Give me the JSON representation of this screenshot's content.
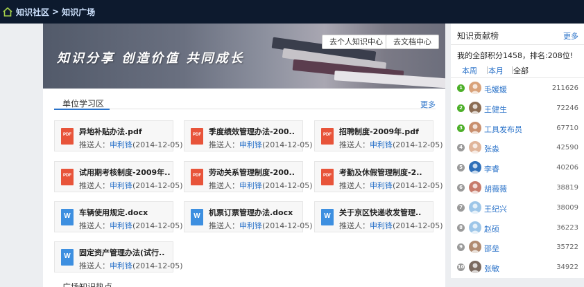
{
  "breadcrumb": {
    "home": "知识社区",
    "separator": ">",
    "current": "知识广场"
  },
  "banner": {
    "slogan": "知识分享  创造价值  共同成长",
    "btn_personal": "去个人知识中心",
    "btn_docs": "去文档中心"
  },
  "section": {
    "title": "单位学习区",
    "more": "更多"
  },
  "docs": [
    {
      "type": "pdf",
      "icon_label": "PDF",
      "title": "异地补贴办法.pdf",
      "by_label": "推送人：",
      "by": "申利锋",
      "date": "(2014-12-05)"
    },
    {
      "type": "pdf",
      "icon_label": "PDF",
      "title": "季度绩效管理办法-200..",
      "by_label": "推送人：",
      "by": "申利锋",
      "date": "(2014-12-05)"
    },
    {
      "type": "pdf",
      "icon_label": "PDF",
      "title": "招聘制度-2009年.pdf",
      "by_label": "推送人：",
      "by": "申利锋",
      "date": "(2014-12-05)"
    },
    {
      "type": "pdf",
      "icon_label": "PDF",
      "title": "试用期考核制度-2009年..",
      "by_label": "推送人：",
      "by": "申利锋",
      "date": "(2014-12-05)"
    },
    {
      "type": "pdf",
      "icon_label": "PDF",
      "title": "劳动关系管理制度-200..",
      "by_label": "推送人：",
      "by": "申利锋",
      "date": "(2014-12-05)"
    },
    {
      "type": "pdf",
      "icon_label": "PDF",
      "title": "考勤及休假管理制度-2..",
      "by_label": "推送人：",
      "by": "申利锋",
      "date": "(2014-12-05)"
    },
    {
      "type": "word",
      "icon_label": "W",
      "title": "车辆使用规定.docx",
      "by_label": "推送人：",
      "by": "申利锋",
      "date": "(2014-12-05)"
    },
    {
      "type": "word",
      "icon_label": "W",
      "title": "机票订票管理办法.docx",
      "by_label": "推送人：",
      "by": "申利锋",
      "date": "(2014-12-05)"
    },
    {
      "type": "word",
      "icon_label": "W",
      "title": "关于京区快递收发管理..",
      "by_label": "推送人：",
      "by": "申利锋",
      "date": "(2014-12-05)"
    },
    {
      "type": "word",
      "icon_label": "W",
      "title": "固定资产管理办法(试行..",
      "by_label": "推送人：",
      "by": "申利锋",
      "date": "(2014-12-05)"
    }
  ],
  "next_section": "广场知识热点",
  "leaderboard": {
    "title": "知识贡献榜",
    "more": "更多",
    "my_score": "我的全部积分1458，排名:208位!",
    "tabs": [
      "本周",
      "本月",
      "全部"
    ],
    "rows": [
      {
        "rank": "1",
        "name": "毛媛媛",
        "score": "211626"
      },
      {
        "rank": "2",
        "name": "王健生",
        "score": "72246"
      },
      {
        "rank": "3",
        "name": "工具发布员",
        "score": "67710"
      },
      {
        "rank": "4",
        "name": "张淼",
        "score": "42590"
      },
      {
        "rank": "5",
        "name": "李睿",
        "score": "40206"
      },
      {
        "rank": "6",
        "name": "胡薇薇",
        "score": "38819"
      },
      {
        "rank": "7",
        "name": "王纪兴",
        "score": "38009"
      },
      {
        "rank": "8",
        "name": "赵硕",
        "score": "36223"
      },
      {
        "rank": "9",
        "name": "邵垒",
        "score": "35722"
      },
      {
        "rank": "10",
        "name": "张敏",
        "score": "34922"
      }
    ]
  },
  "colors": {
    "topbar": "#0d1a2e",
    "link": "#2b73c9",
    "pdf": "#e8543a",
    "word": "#3d8fe0",
    "rank_top": "#4caf28",
    "rank_other": "#9a9a9a"
  }
}
